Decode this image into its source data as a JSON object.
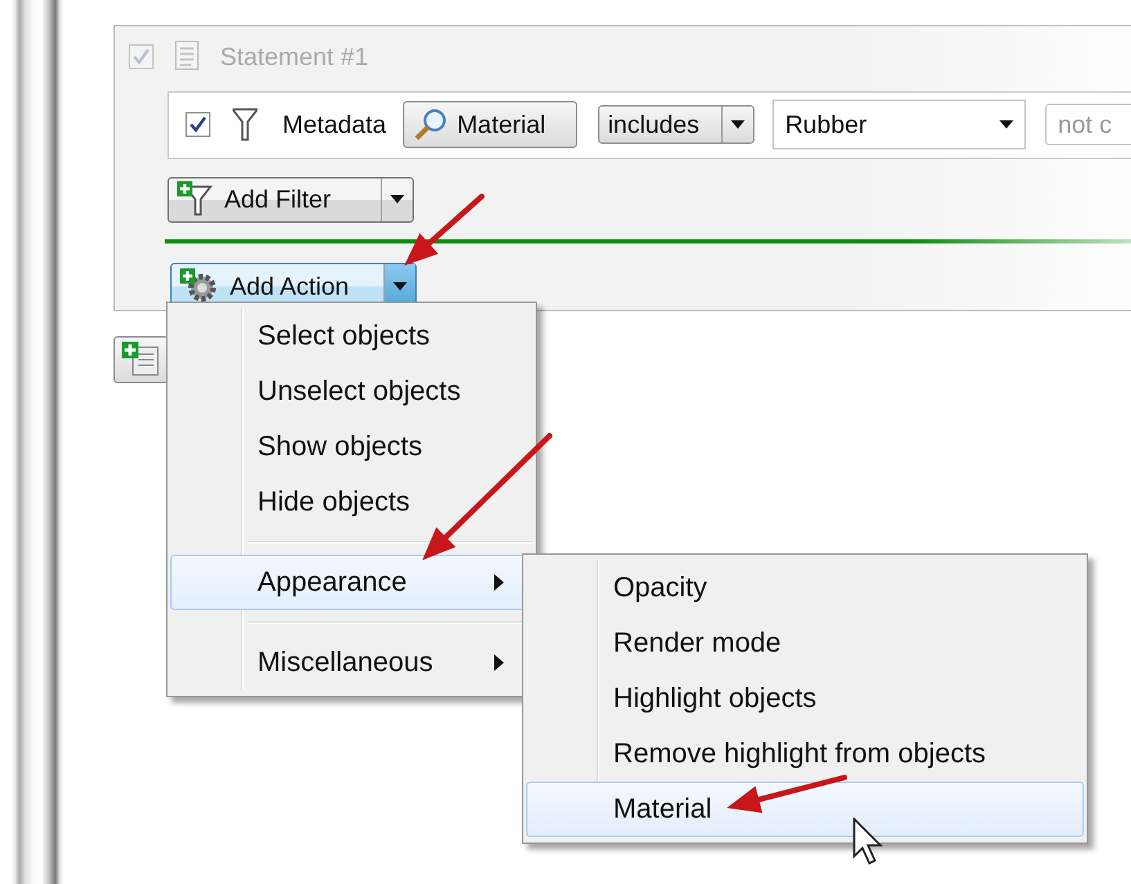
{
  "statement": {
    "title": "Statement #1",
    "checked": true,
    "disabled": true
  },
  "filter": {
    "checked": true,
    "label": "Metadata",
    "property": "Material",
    "operator": "includes",
    "value": "Rubber",
    "next_field": "not c"
  },
  "add_filter": {
    "label": "Add Filter"
  },
  "add_action": {
    "label": "Add Action",
    "pressed": true
  },
  "menu": {
    "items": [
      {
        "kind": "item",
        "label": "Select objects",
        "selected": false,
        "submenu": false
      },
      {
        "kind": "item",
        "label": "Unselect objects",
        "selected": false,
        "submenu": false
      },
      {
        "kind": "item",
        "label": "Show objects",
        "selected": false,
        "submenu": false
      },
      {
        "kind": "item",
        "label": "Hide objects",
        "selected": false,
        "submenu": false
      },
      {
        "kind": "separator"
      },
      {
        "kind": "item",
        "label": "Appearance",
        "selected": true,
        "submenu": true
      },
      {
        "kind": "separator"
      },
      {
        "kind": "item",
        "label": "Miscellaneous",
        "selected": false,
        "submenu": true
      }
    ]
  },
  "submenu": {
    "items": [
      {
        "kind": "item",
        "label": "Opacity",
        "selected": false,
        "submenu": false
      },
      {
        "kind": "item",
        "label": "Render mode",
        "selected": false,
        "submenu": false
      },
      {
        "kind": "item",
        "label": "Highlight objects",
        "selected": false,
        "submenu": false
      },
      {
        "kind": "item",
        "label": "Remove highlight from objects",
        "selected": false,
        "submenu": false
      },
      {
        "kind": "item",
        "label": "Material",
        "selected": true,
        "submenu": false
      }
    ]
  }
}
